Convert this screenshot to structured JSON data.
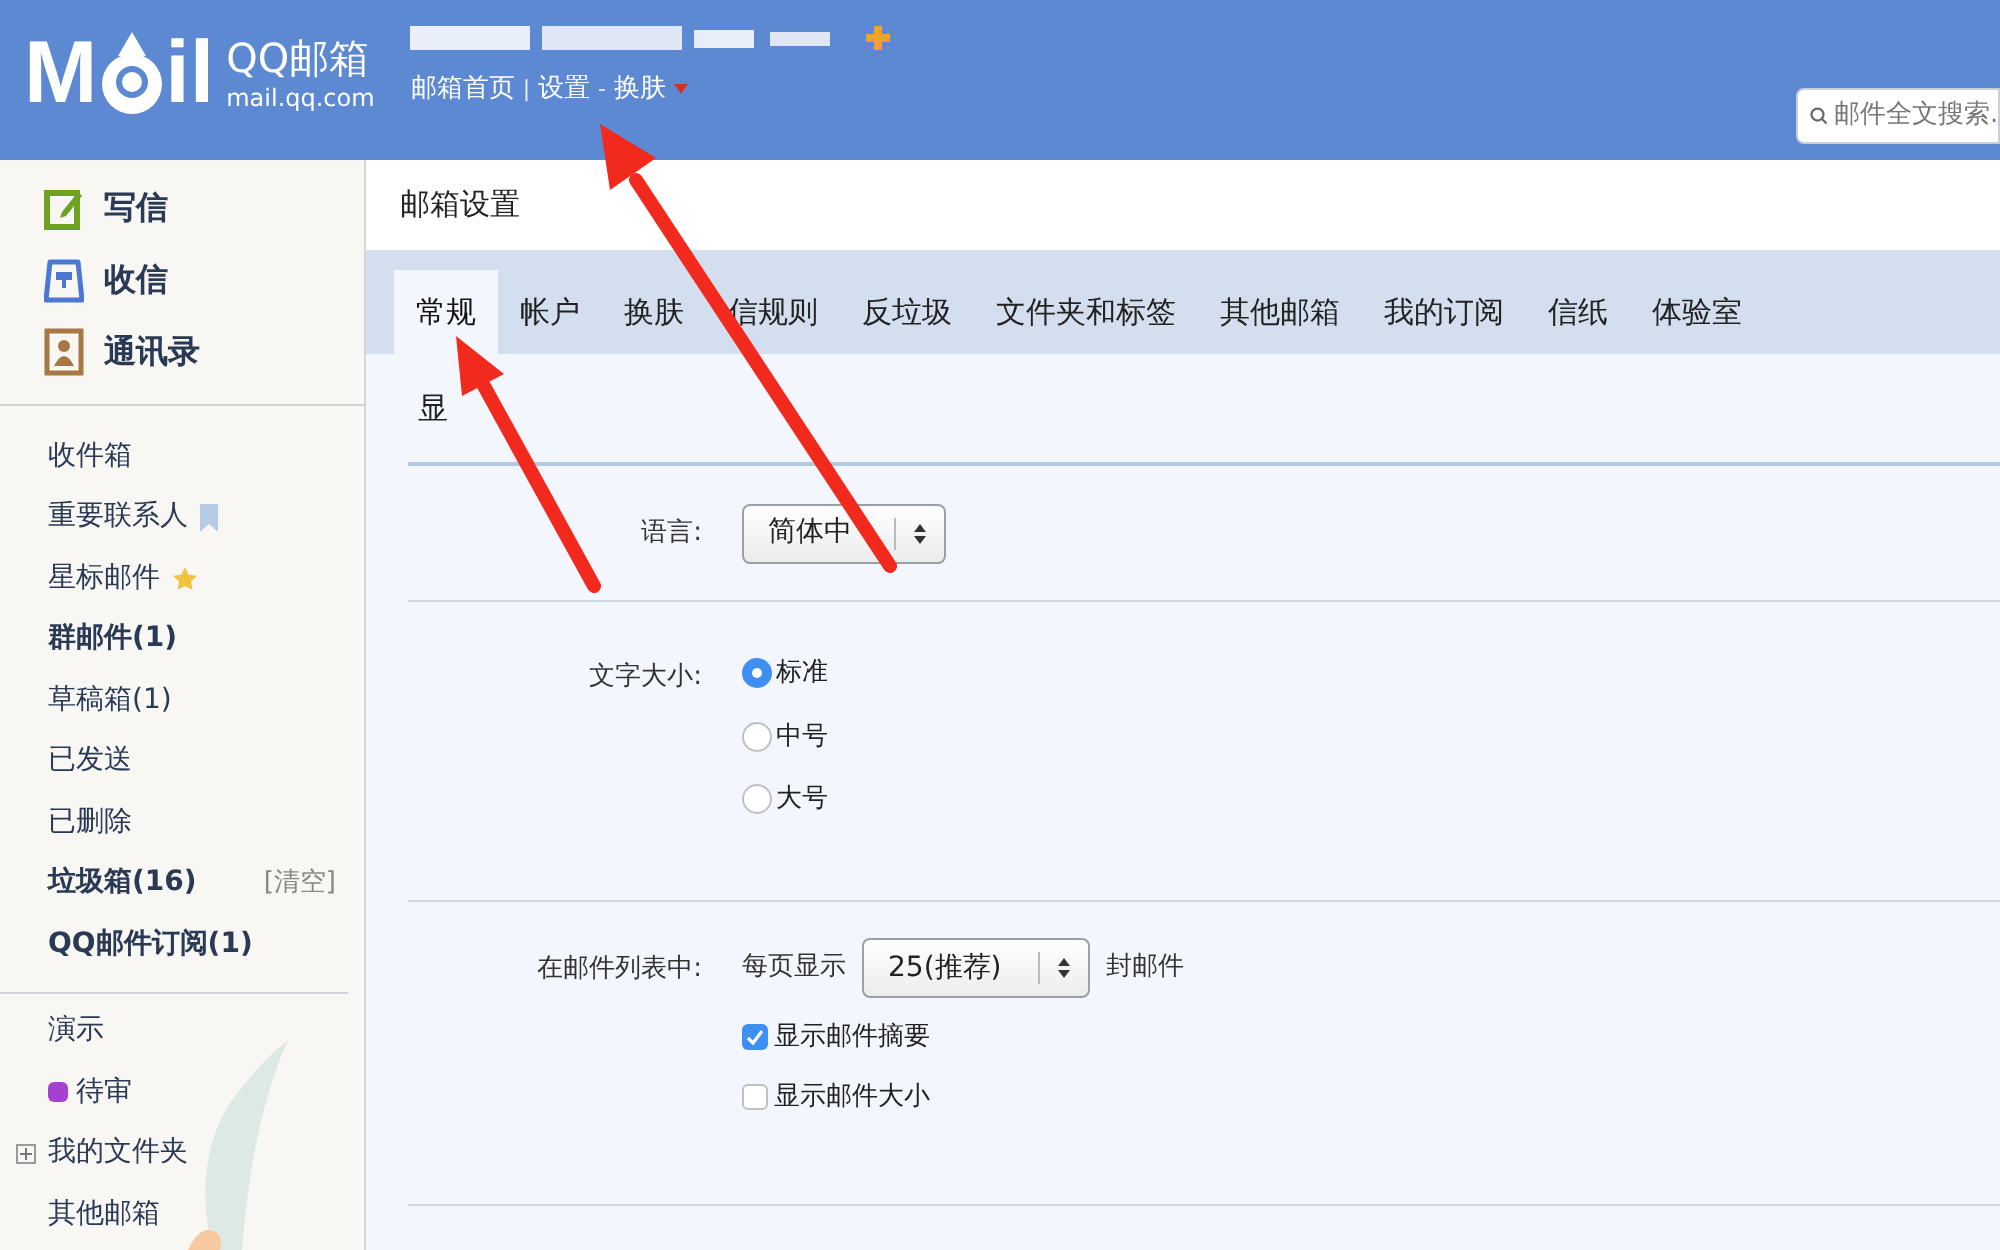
{
  "header": {
    "logo": {
      "left": "M",
      "right": "il",
      "brand": "QQ邮箱",
      "domain": "mail.qq.com"
    },
    "nav": [
      {
        "kind": "link",
        "label": "邮箱首页"
      },
      {
        "kind": "separator",
        "label": "|"
      },
      {
        "kind": "link",
        "label": "设置"
      },
      {
        "kind": "separator",
        "label": "-"
      },
      {
        "kind": "link",
        "label": "换肤"
      }
    ],
    "search": {
      "placeholder": "邮件全文搜索."
    }
  },
  "sidebar": {
    "actions": [
      {
        "kind": "compose",
        "label": "写信"
      },
      {
        "kind": "inbox",
        "label": "收信"
      },
      {
        "kind": "contacts",
        "label": "通讯录"
      }
    ],
    "folders": [
      {
        "label": "收件箱",
        "bold": false
      },
      {
        "label": "重要联系人",
        "bold": false,
        "kind": "bookmark"
      },
      {
        "label": "星标邮件",
        "bold": false,
        "kind": "star"
      },
      {
        "label": "群邮件(1)",
        "bold": true
      },
      {
        "label": "草稿箱(1)",
        "bold": false
      },
      {
        "label": "已发送",
        "bold": false
      },
      {
        "label": "已删除",
        "bold": false
      },
      {
        "label": "垃圾箱(16)",
        "bold": true,
        "action": "[清空]"
      },
      {
        "label": "QQ邮件订阅(1)",
        "bold": true
      }
    ],
    "more": [
      {
        "kind": "plain",
        "label": "演示"
      },
      {
        "kind": "tag",
        "label": "待审",
        "color": "#a640d0"
      },
      {
        "kind": "group",
        "label": "我的文件夹",
        "expanded": false
      },
      {
        "kind": "plain",
        "label": "其他邮箱"
      }
    ]
  },
  "main": {
    "title": "邮箱设置",
    "tabs": [
      {
        "label": "常规",
        "selected": true
      },
      {
        "label": "帐户",
        "selected": false
      },
      {
        "label": "换肤",
        "selected": false
      },
      {
        "label": "信规则",
        "selected": false
      },
      {
        "label": "反垃圾",
        "selected": false
      },
      {
        "label": "文件夹和标签",
        "selected": false
      },
      {
        "label": "其他邮箱",
        "selected": false
      },
      {
        "label": "我的订阅",
        "selected": false
      },
      {
        "label": "信纸",
        "selected": false
      },
      {
        "label": "体验室",
        "selected": false
      }
    ],
    "section_title": "显",
    "language": {
      "label": "语言:",
      "value": "简体中"
    },
    "font_size": {
      "label": "文字大小:",
      "options": [
        {
          "label": "标准",
          "selected": true
        },
        {
          "label": "中号",
          "selected": false
        },
        {
          "label": "大号",
          "selected": false
        }
      ]
    },
    "list": {
      "label": "在邮件列表中:",
      "prefix": "每页显示",
      "value": "25(推荐)",
      "suffix": "封邮件",
      "checks": [
        {
          "label": "显示邮件摘要",
          "checked": true
        },
        {
          "label": "显示邮件大小",
          "checked": false
        }
      ]
    }
  }
}
